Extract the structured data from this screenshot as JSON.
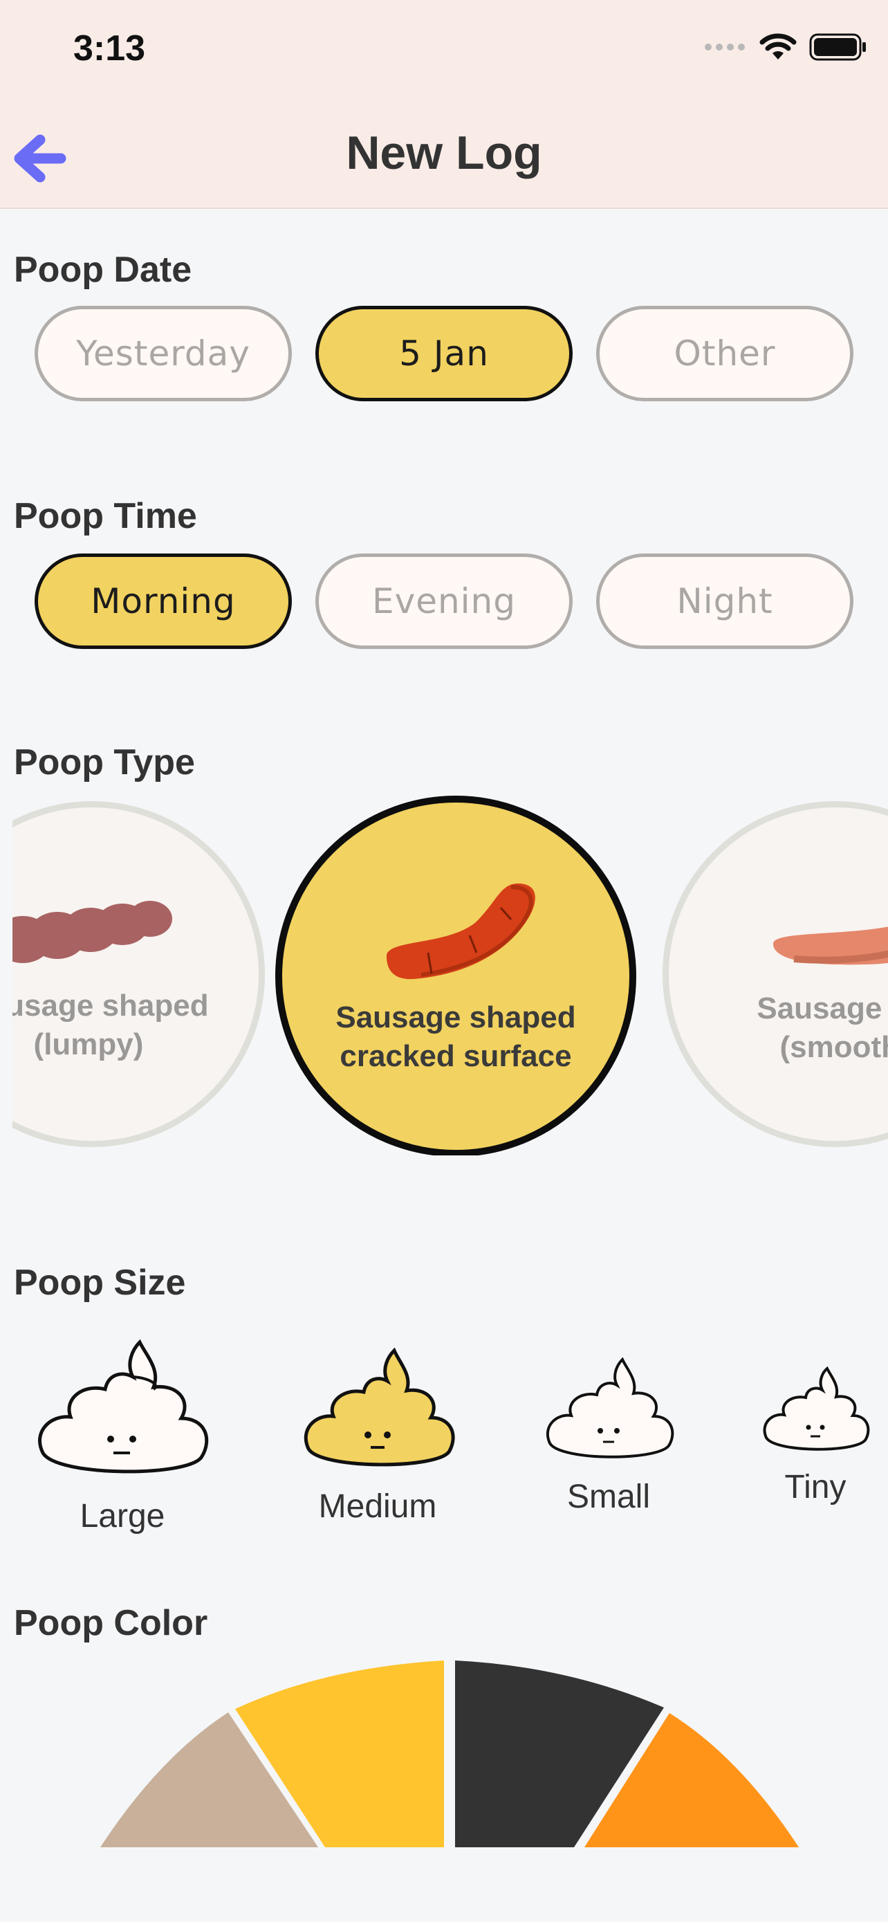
{
  "status_bar": {
    "time": "3:13",
    "signal_icon": "signal-dots-icon",
    "wifi_icon": "wifi-icon",
    "battery_icon": "battery-icon"
  },
  "nav": {
    "title": "New Log",
    "back_icon": "arrow-left-icon",
    "accent_color": "#6b6cf6"
  },
  "poop_date": {
    "title": "Poop Date",
    "options": [
      "Yesterday",
      "5 Jan",
      "Other"
    ],
    "selected": "5 Jan"
  },
  "poop_time": {
    "title": "Poop Time",
    "options": [
      "Morning",
      "Evening",
      "Night"
    ],
    "selected": "Morning"
  },
  "poop_type": {
    "title": "Poop Type",
    "items": [
      {
        "line1": "Sausage shaped",
        "line2": "(lumpy)"
      },
      {
        "line1": "Sausage shaped",
        "line2": "cracked surface"
      },
      {
        "line1": "Sausage shaped",
        "line2": "(smooth soft)"
      }
    ],
    "selected_index": 1
  },
  "poop_size": {
    "title": "Poop Size",
    "options": [
      "Large",
      "Medium",
      "Small",
      "Tiny"
    ],
    "selected": "Medium"
  },
  "poop_color": {
    "title": "Poop Color",
    "colors": [
      "#c8b09a",
      "#ffc42e",
      "#333333",
      "#ff9419"
    ]
  },
  "theme": {
    "selected_fill": "#f2d260",
    "header_bg": "#f9ece7"
  }
}
